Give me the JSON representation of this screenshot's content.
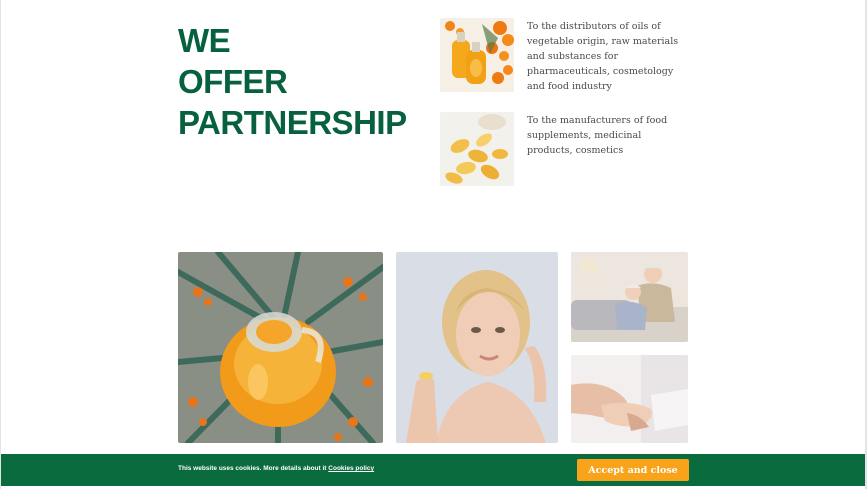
{
  "headline": {
    "line1": "WE",
    "line2": "OFFER",
    "line3": "PARTNERSHIP"
  },
  "offers": [
    {
      "text": "To the distributors of oils of vegetable origin, raw materials and substances for pharmaceuticals, cosmetology and food industry",
      "image": "sea-buckthorn-oil-bottles"
    },
    {
      "text": "To the manufacturers of food supplements, medicinal products, cosmetics",
      "image": "softgel-capsules"
    }
  ],
  "gallery": [
    {
      "image": "sea-buckthorn-oil-jar"
    },
    {
      "image": "woman-holding-capsule"
    },
    {
      "image": "elderly-couple-sofa"
    },
    {
      "image": "caring-hands"
    }
  ],
  "cookie": {
    "text": "This website uses cookies. More details about it",
    "link": "Cookies policy",
    "button": "Accept and close"
  },
  "colors": {
    "brand_green": "#07613f",
    "accent_orange": "#f9a31a",
    "cookie_bar": "#0a6b3f"
  }
}
